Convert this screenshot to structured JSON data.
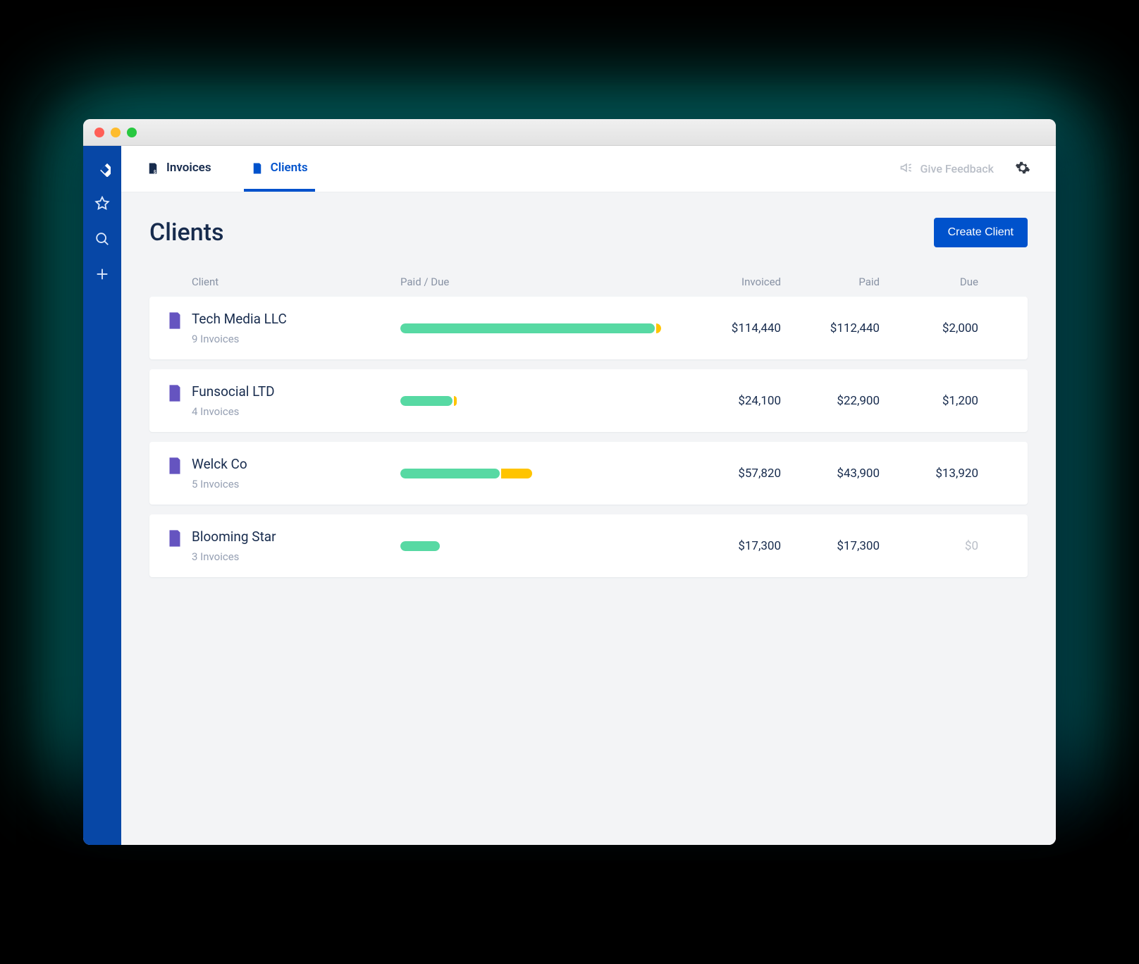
{
  "header": {
    "tabs": [
      {
        "label": "Invoices",
        "active": false
      },
      {
        "label": "Clients",
        "active": true
      }
    ],
    "feedback_label": "Give Feedback"
  },
  "page": {
    "title": "Clients",
    "create_button": "Create Client"
  },
  "columns": {
    "client": "Client",
    "progress": "Paid / Due",
    "invoiced": "Invoiced",
    "paid": "Paid",
    "due": "Due"
  },
  "clients": [
    {
      "name": "Tech Media LLC",
      "sub": "9 Invoices",
      "invoiced": "$114,440",
      "paid": "$112,440",
      "due": "$2,000",
      "paid_pct": 98,
      "due_pct": 2,
      "due_muted": false
    },
    {
      "name": "Funsocial LTD",
      "sub": "4 Invoices",
      "invoiced": "$24,100",
      "paid": "$22,900",
      "due": "$1,200",
      "paid_pct": 20,
      "due_pct": 1,
      "due_muted": false
    },
    {
      "name": "Welck Co",
      "sub": "5 Invoices",
      "invoiced": "$57,820",
      "paid": "$43,900",
      "due": "$13,920",
      "paid_pct": 38,
      "due_pct": 12,
      "due_muted": false
    },
    {
      "name": "Blooming Star",
      "sub": "3 Invoices",
      "invoiced": "$17,300",
      "paid": "$17,300",
      "due": "$0",
      "paid_pct": 15,
      "due_pct": 0,
      "due_muted": true
    }
  ]
}
